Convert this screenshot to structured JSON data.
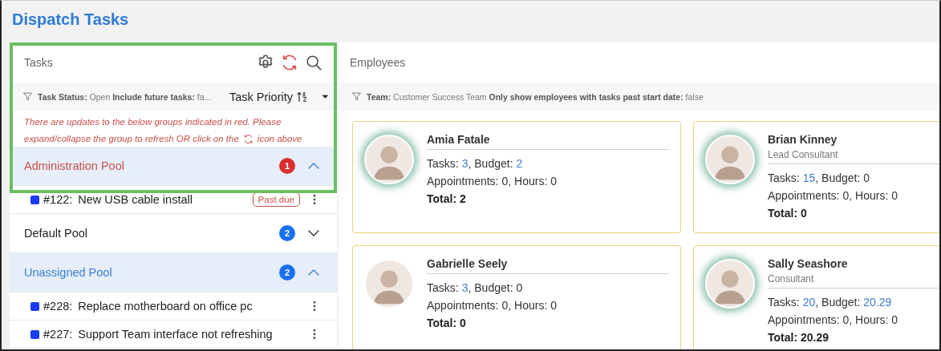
{
  "page": {
    "title": "Dispatch Tasks"
  },
  "tasks_panel": {
    "title": "Tasks",
    "filter": "**Task Status:** Open **Include future tasks:** fa...",
    "sort": {
      "label": "Task Priority"
    },
    "notice_line": "There are updates to the below groups indicated in red. Please",
    "notice_before": "expand/collapse the group to refresh OR click on the",
    "notice_after": "icon above",
    "groups": [
      {
        "name": "Administration Pool",
        "count": "1",
        "updated": true,
        "expanded": true,
        "tasks": [
          {
            "id": "#122:",
            "title": "New USB cable install",
            "color": "#1a3cf5",
            "badge": "Past due"
          }
        ]
      },
      {
        "name": "Default Pool",
        "count": "2",
        "updated": false,
        "expanded": false
      },
      {
        "name": "Unassigned Pool",
        "count": "2",
        "updated": false,
        "expanded": true,
        "tasks": [
          {
            "id": "#228:",
            "title": "Replace motherboard on office pc",
            "color": "#1a3cf5"
          },
          {
            "id": "#227:",
            "title": "Support Team interface not refreshing",
            "color": "#1a3cf5"
          }
        ]
      }
    ]
  },
  "employees_panel": {
    "title": "Employees",
    "filter": "**Team:** Customer Success Team **Only show employees with tasks past start date:** false",
    "employees": [
      {
        "name": "Amia Fatale",
        "highlighted": true,
        "stats": [
          [
            {
              "label": "Tasks:",
              "value": "3",
              "linked": true
            },
            {
              "label": ", Budget:",
              "value": "2",
              "linked": true
            }
          ],
          [
            {
              "label": "Appointments:",
              "value": "0",
              "linked": false
            },
            {
              "label": ", Hours:",
              "value": "0",
              "linked": false
            }
          ]
        ],
        "total": "Total: 2"
      },
      {
        "name": "Brian Kinney",
        "role": "Lead Consultant",
        "highlighted": true,
        "stats": [
          [
            {
              "label": "Tasks:",
              "value": "15",
              "linked": true
            },
            {
              "label": ", Budget:",
              "value": "0",
              "linked": false
            }
          ],
          [
            {
              "label": "Appointments:",
              "value": "0",
              "linked": false
            },
            {
              "label": ", Hours:",
              "value": "0",
              "linked": false
            }
          ]
        ],
        "total": "Total: 0"
      },
      {
        "name": "Gabrielle Seely",
        "highlighted": false,
        "stats": [
          [
            {
              "label": "Tasks:",
              "value": "3",
              "linked": true
            },
            {
              "label": ", Budget:",
              "value": "0",
              "linked": false
            }
          ],
          [
            {
              "label": "Appointments:",
              "value": "0",
              "linked": false
            },
            {
              "label": ", Hours:",
              "value": "0",
              "linked": false
            }
          ]
        ],
        "total": "Total: 0"
      },
      {
        "name": "Sally Seashore",
        "role": "Consultant",
        "highlighted": true,
        "stats": [
          [
            {
              "label": "Tasks:",
              "value": "20",
              "linked": true
            },
            {
              "label": ", Budget:",
              "value": "20.29",
              "linked": true
            }
          ],
          [
            {
              "label": "Appointments:",
              "value": "0",
              "linked": false
            },
            {
              "label": ", Hours:",
              "value": "0",
              "linked": false
            }
          ]
        ],
        "total": "Total: 20.29"
      }
    ]
  }
}
